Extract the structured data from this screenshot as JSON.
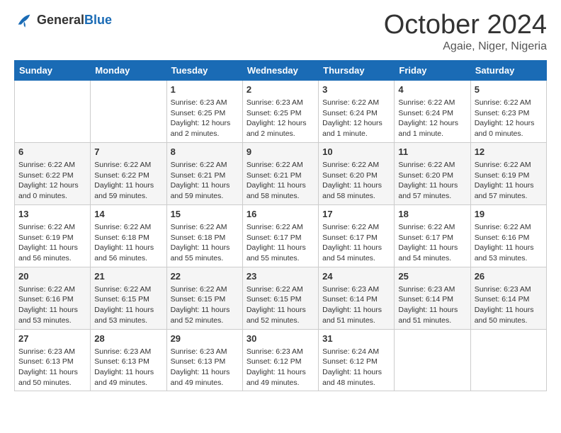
{
  "header": {
    "logo_general": "General",
    "logo_blue": "Blue",
    "month_title": "October 2024",
    "location": "Agaie, Niger, Nigeria"
  },
  "days_of_week": [
    "Sunday",
    "Monday",
    "Tuesday",
    "Wednesday",
    "Thursday",
    "Friday",
    "Saturday"
  ],
  "weeks": [
    [
      {
        "day": "",
        "lines": []
      },
      {
        "day": "",
        "lines": []
      },
      {
        "day": "1",
        "lines": [
          "Sunrise: 6:23 AM",
          "Sunset: 6:25 PM",
          "Daylight: 12 hours",
          "and 2 minutes."
        ]
      },
      {
        "day": "2",
        "lines": [
          "Sunrise: 6:23 AM",
          "Sunset: 6:25 PM",
          "Daylight: 12 hours",
          "and 2 minutes."
        ]
      },
      {
        "day": "3",
        "lines": [
          "Sunrise: 6:22 AM",
          "Sunset: 6:24 PM",
          "Daylight: 12 hours",
          "and 1 minute."
        ]
      },
      {
        "day": "4",
        "lines": [
          "Sunrise: 6:22 AM",
          "Sunset: 6:24 PM",
          "Daylight: 12 hours",
          "and 1 minute."
        ]
      },
      {
        "day": "5",
        "lines": [
          "Sunrise: 6:22 AM",
          "Sunset: 6:23 PM",
          "Daylight: 12 hours",
          "and 0 minutes."
        ]
      }
    ],
    [
      {
        "day": "6",
        "lines": [
          "Sunrise: 6:22 AM",
          "Sunset: 6:22 PM",
          "Daylight: 12 hours",
          "and 0 minutes."
        ]
      },
      {
        "day": "7",
        "lines": [
          "Sunrise: 6:22 AM",
          "Sunset: 6:22 PM",
          "Daylight: 11 hours",
          "and 59 minutes."
        ]
      },
      {
        "day": "8",
        "lines": [
          "Sunrise: 6:22 AM",
          "Sunset: 6:21 PM",
          "Daylight: 11 hours",
          "and 59 minutes."
        ]
      },
      {
        "day": "9",
        "lines": [
          "Sunrise: 6:22 AM",
          "Sunset: 6:21 PM",
          "Daylight: 11 hours",
          "and 58 minutes."
        ]
      },
      {
        "day": "10",
        "lines": [
          "Sunrise: 6:22 AM",
          "Sunset: 6:20 PM",
          "Daylight: 11 hours",
          "and 58 minutes."
        ]
      },
      {
        "day": "11",
        "lines": [
          "Sunrise: 6:22 AM",
          "Sunset: 6:20 PM",
          "Daylight: 11 hours",
          "and 57 minutes."
        ]
      },
      {
        "day": "12",
        "lines": [
          "Sunrise: 6:22 AM",
          "Sunset: 6:19 PM",
          "Daylight: 11 hours",
          "and 57 minutes."
        ]
      }
    ],
    [
      {
        "day": "13",
        "lines": [
          "Sunrise: 6:22 AM",
          "Sunset: 6:19 PM",
          "Daylight: 11 hours",
          "and 56 minutes."
        ]
      },
      {
        "day": "14",
        "lines": [
          "Sunrise: 6:22 AM",
          "Sunset: 6:18 PM",
          "Daylight: 11 hours",
          "and 56 minutes."
        ]
      },
      {
        "day": "15",
        "lines": [
          "Sunrise: 6:22 AM",
          "Sunset: 6:18 PM",
          "Daylight: 11 hours",
          "and 55 minutes."
        ]
      },
      {
        "day": "16",
        "lines": [
          "Sunrise: 6:22 AM",
          "Sunset: 6:17 PM",
          "Daylight: 11 hours",
          "and 55 minutes."
        ]
      },
      {
        "day": "17",
        "lines": [
          "Sunrise: 6:22 AM",
          "Sunset: 6:17 PM",
          "Daylight: 11 hours",
          "and 54 minutes."
        ]
      },
      {
        "day": "18",
        "lines": [
          "Sunrise: 6:22 AM",
          "Sunset: 6:17 PM",
          "Daylight: 11 hours",
          "and 54 minutes."
        ]
      },
      {
        "day": "19",
        "lines": [
          "Sunrise: 6:22 AM",
          "Sunset: 6:16 PM",
          "Daylight: 11 hours",
          "and 53 minutes."
        ]
      }
    ],
    [
      {
        "day": "20",
        "lines": [
          "Sunrise: 6:22 AM",
          "Sunset: 6:16 PM",
          "Daylight: 11 hours",
          "and 53 minutes."
        ]
      },
      {
        "day": "21",
        "lines": [
          "Sunrise: 6:22 AM",
          "Sunset: 6:15 PM",
          "Daylight: 11 hours",
          "and 53 minutes."
        ]
      },
      {
        "day": "22",
        "lines": [
          "Sunrise: 6:22 AM",
          "Sunset: 6:15 PM",
          "Daylight: 11 hours",
          "and 52 minutes."
        ]
      },
      {
        "day": "23",
        "lines": [
          "Sunrise: 6:22 AM",
          "Sunset: 6:15 PM",
          "Daylight: 11 hours",
          "and 52 minutes."
        ]
      },
      {
        "day": "24",
        "lines": [
          "Sunrise: 6:23 AM",
          "Sunset: 6:14 PM",
          "Daylight: 11 hours",
          "and 51 minutes."
        ]
      },
      {
        "day": "25",
        "lines": [
          "Sunrise: 6:23 AM",
          "Sunset: 6:14 PM",
          "Daylight: 11 hours",
          "and 51 minutes."
        ]
      },
      {
        "day": "26",
        "lines": [
          "Sunrise: 6:23 AM",
          "Sunset: 6:14 PM",
          "Daylight: 11 hours",
          "and 50 minutes."
        ]
      }
    ],
    [
      {
        "day": "27",
        "lines": [
          "Sunrise: 6:23 AM",
          "Sunset: 6:13 PM",
          "Daylight: 11 hours",
          "and 50 minutes."
        ]
      },
      {
        "day": "28",
        "lines": [
          "Sunrise: 6:23 AM",
          "Sunset: 6:13 PM",
          "Daylight: 11 hours",
          "and 49 minutes."
        ]
      },
      {
        "day": "29",
        "lines": [
          "Sunrise: 6:23 AM",
          "Sunset: 6:13 PM",
          "Daylight: 11 hours",
          "and 49 minutes."
        ]
      },
      {
        "day": "30",
        "lines": [
          "Sunrise: 6:23 AM",
          "Sunset: 6:12 PM",
          "Daylight: 11 hours",
          "and 49 minutes."
        ]
      },
      {
        "day": "31",
        "lines": [
          "Sunrise: 6:24 AM",
          "Sunset: 6:12 PM",
          "Daylight: 11 hours",
          "and 48 minutes."
        ]
      },
      {
        "day": "",
        "lines": []
      },
      {
        "day": "",
        "lines": []
      }
    ]
  ]
}
